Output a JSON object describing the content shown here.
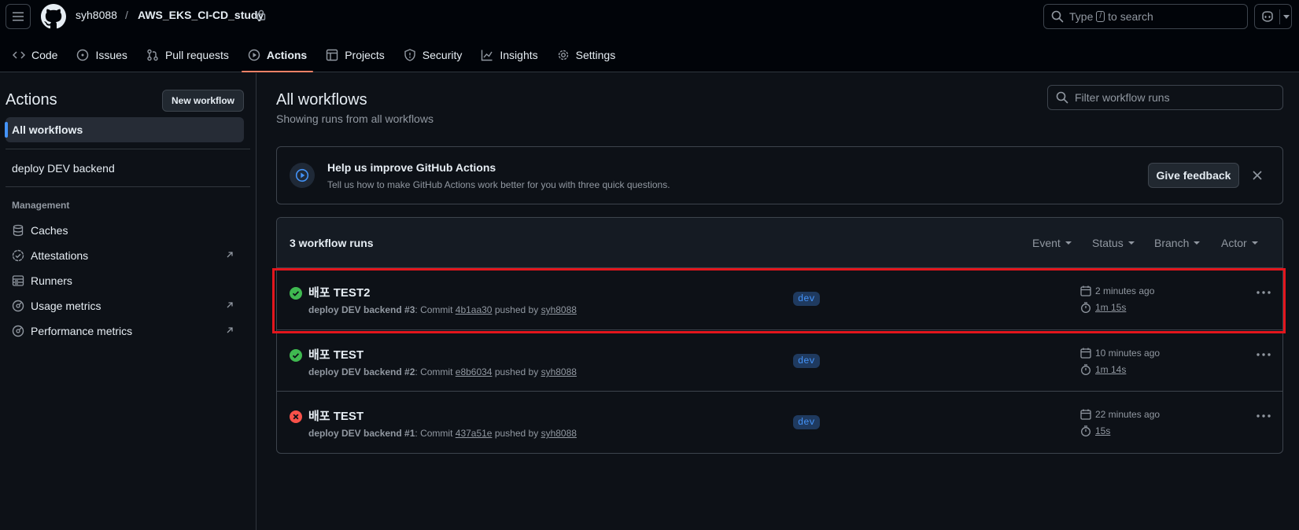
{
  "header": {
    "owner": "syh8088",
    "separator": "/",
    "repo": "AWS_EKS_CI-CD_study",
    "search": {
      "prefix": "Type",
      "key": "/",
      "suffix": "to search"
    }
  },
  "repo_tabs": [
    {
      "label": "Code",
      "icon": "code-icon"
    },
    {
      "label": "Issues",
      "icon": "issue-icon"
    },
    {
      "label": "Pull requests",
      "icon": "pull-request-icon"
    },
    {
      "label": "Actions",
      "icon": "play-icon",
      "selected": true
    },
    {
      "label": "Projects",
      "icon": "table-icon"
    },
    {
      "label": "Security",
      "icon": "shield-icon"
    },
    {
      "label": "Insights",
      "icon": "graph-icon"
    },
    {
      "label": "Settings",
      "icon": "gear-icon"
    }
  ],
  "sidebar": {
    "title": "Actions",
    "new_workflow": "New workflow",
    "all_workflows": "All workflows",
    "workflows": [
      "deploy DEV backend"
    ],
    "management_heading": "Management",
    "management": [
      {
        "label": "Caches",
        "icon": "database-icon",
        "external": false
      },
      {
        "label": "Attestations",
        "icon": "verified-icon",
        "external": true
      },
      {
        "label": "Runners",
        "icon": "server-icon",
        "external": false
      },
      {
        "label": "Usage metrics",
        "icon": "meter-icon",
        "external": true
      },
      {
        "label": "Performance metrics",
        "icon": "meter-icon",
        "external": true
      }
    ]
  },
  "main": {
    "title": "All workflows",
    "subtitle": "Showing runs from all workflows",
    "filter_placeholder": "Filter workflow runs"
  },
  "banner": {
    "title": "Help us improve GitHub Actions",
    "text": "Tell us how to make GitHub Actions work better for you with three quick questions.",
    "button": "Give feedback"
  },
  "runs": {
    "count": "3 workflow runs",
    "filters": [
      "Event",
      "Status",
      "Branch",
      "Actor"
    ],
    "items": [
      {
        "title": "배포 TEST2",
        "status": "success",
        "workflow": "deploy DEV backend",
        "number": "#3",
        "commit_label": "Commit",
        "commit": "4b1aa30",
        "pushed_by": "pushed by",
        "user": "syh8088",
        "branch": "dev",
        "time": "2 minutes ago",
        "duration": "1m 15s"
      },
      {
        "title": "배포 TEST",
        "status": "success",
        "workflow": "deploy DEV backend",
        "number": "#2",
        "commit_label": "Commit",
        "commit": "e8b6034",
        "pushed_by": "pushed by",
        "user": "syh8088",
        "branch": "dev",
        "time": "10 minutes ago",
        "duration": "1m 14s"
      },
      {
        "title": "배포 TEST",
        "status": "failure",
        "workflow": "deploy DEV backend",
        "number": "#1",
        "commit_label": "Commit",
        "commit": "437a51e",
        "pushed_by": "pushed by",
        "user": "syh8088",
        "branch": "dev",
        "time": "22 minutes ago",
        "duration": "15s"
      }
    ]
  },
  "colors": {
    "success": "#3fb950",
    "failure": "#f85149",
    "accent": "#4493f8",
    "highlight": "#e3161d"
  }
}
